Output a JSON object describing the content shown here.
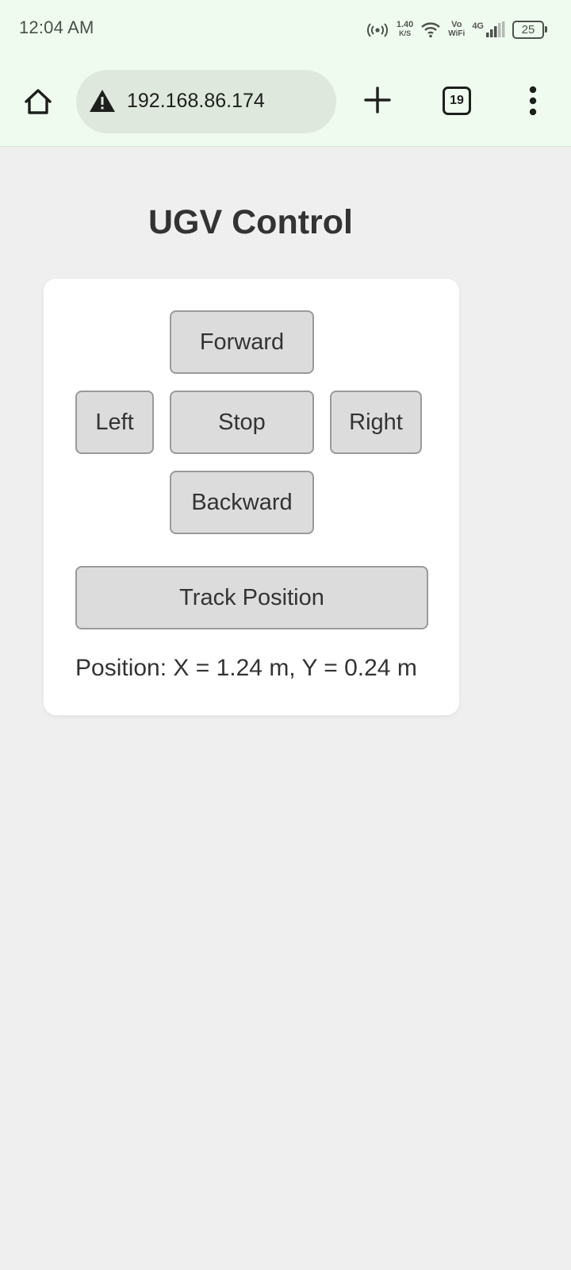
{
  "status_bar": {
    "time": "12:04 AM",
    "speed_value": "1.40",
    "speed_unit": "K/S",
    "vo_label": "Vo",
    "wifi_label": "WiFi",
    "network_label": "4G",
    "battery": "25"
  },
  "browser": {
    "url": "192.168.86.174",
    "tab_count": "19",
    "icons": {
      "home": "home-icon",
      "warning": "warning-icon",
      "new_tab": "plus-icon",
      "menu": "more-vertical-icon"
    }
  },
  "page": {
    "title": "UGV Control",
    "buttons": {
      "forward": "Forward",
      "left": "Left",
      "stop": "Stop",
      "right": "Right",
      "backward": "Backward",
      "track": "Track Position"
    },
    "position_text": "Position: X = 1.24 m, Y = 0.24 m"
  },
  "colors": {
    "browser_chrome": "#f0fbef",
    "url_bar": "#dee8dc",
    "page_background": "#efefef",
    "card": "#ffffff",
    "button": "#dcdcdc",
    "button_border": "#9a9a9a",
    "text": "#333333"
  }
}
